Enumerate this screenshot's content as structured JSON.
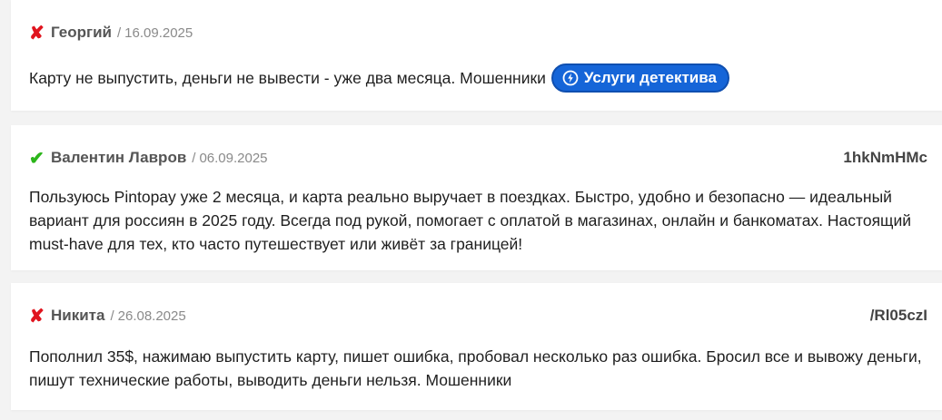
{
  "reviews": [
    {
      "status": "negative",
      "mark": "✘",
      "author": "Георгий",
      "date": "16.09.2025",
      "code": "",
      "text": "Карту не выпустить, деньги не вывести - уже два месяца. Мошенники",
      "button_label": "Услуги детектива"
    },
    {
      "status": "positive",
      "mark": "✔",
      "author": "Валентин Лавров",
      "date": "06.09.2025",
      "code": "1hkNmHMc",
      "text": "Пользуюсь Pintopay уже 2 месяца, и карта реально выручает в поездках. Быстро, удобно и безопасно — идеальный вариант для россиян в 2025 году. Всегда под рукой, помогает с оплатой в магазинах, онлайн и банкоматах. Настоящий must-have для тех, кто часто путешествует или живёт за границей!"
    },
    {
      "status": "negative",
      "mark": "✘",
      "author": "Никита",
      "date": "26.08.2025",
      "code": "/Rl05czI",
      "text": "Пополнил 35$, нажимаю выпустить карту, пишет ошибка, пробовал несколько раз ошибка. Бросил все и вывожу деньги, пишут технические работы, выводить деньги нельзя. Мошенники"
    }
  ],
  "separator": "/",
  "colors": {
    "negative": "#e0141e",
    "positive": "#2bb51a",
    "button": "#1565d8"
  }
}
